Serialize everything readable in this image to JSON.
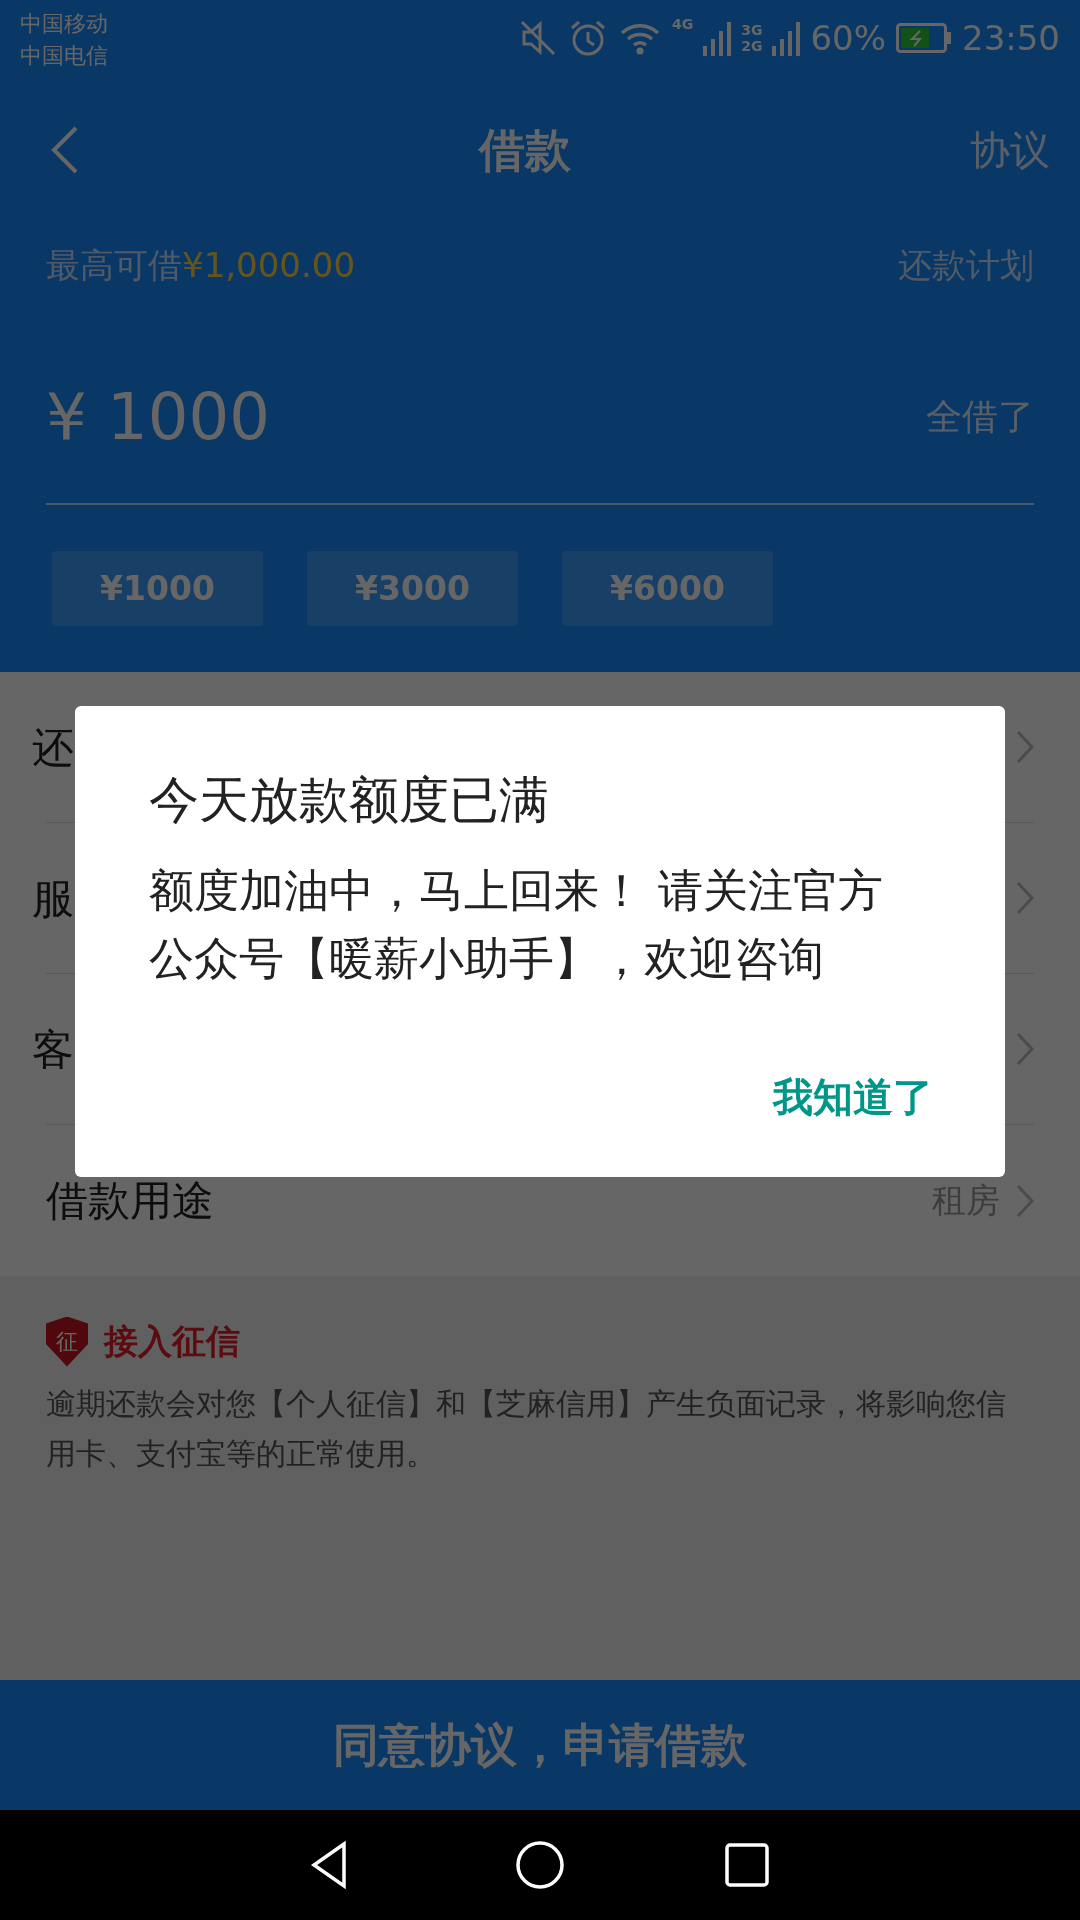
{
  "status_bar": {
    "carriers": [
      "中国移动",
      "中国电信"
    ],
    "network_1": "4G",
    "network_2": [
      "3G",
      "2G"
    ],
    "battery": "60%",
    "time": "23:50"
  },
  "header": {
    "title": "借款",
    "action": "协议"
  },
  "limit": {
    "label": "最高可借",
    "amount": "¥1,000.00",
    "link": "还款计划"
  },
  "amount": {
    "currency": "¥",
    "value": "1000",
    "action": "全借了"
  },
  "chips": [
    {
      "label": "¥1000"
    },
    {
      "label": "¥3000"
    },
    {
      "label": "¥6000"
    }
  ],
  "rows": [
    {
      "label": "还"
    },
    {
      "label": "服"
    },
    {
      "label": "客"
    },
    {
      "label": "借款用途",
      "value": "租房"
    }
  ],
  "credit": {
    "badge": "征",
    "title": "接入征信",
    "text": "逾期还款会对您【个人征信】和【芝麻信用】产生负面记录，将影响您信用卡、支付宝等的正常使用。"
  },
  "submit": "同意协议，申请借款",
  "dialog": {
    "title": "今天放款额度已满",
    "message": "额度加油中，马上回来！ 请关注官方公众号【暖薪小助手】，欢迎咨询",
    "button": "我知道了"
  }
}
